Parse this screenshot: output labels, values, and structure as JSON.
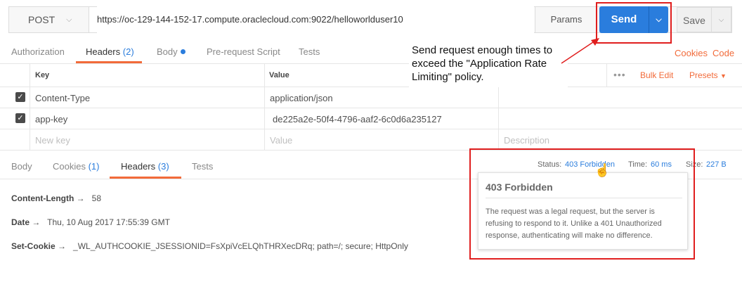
{
  "request": {
    "method": "POST",
    "url": "https://oc-129-144-152-17.compute.oraclecloud.com:9022/helloworlduser10",
    "params_label": "Params",
    "send_label": "Send",
    "save_label": "Save"
  },
  "request_tabs": [
    {
      "label": "Authorization"
    },
    {
      "label": "Headers",
      "count": "(2)"
    },
    {
      "label": "Body"
    },
    {
      "label": "Pre-request Script"
    },
    {
      "label": "Tests"
    }
  ],
  "links": {
    "cookies": "Cookies",
    "code": "Code"
  },
  "headers_table": {
    "col_key": "Key",
    "col_value": "Value",
    "bulk_edit": "Bulk Edit",
    "presets": "Presets",
    "rows": [
      {
        "key": "Content-Type",
        "value": "application/json",
        "checked": true
      },
      {
        "key": "app-key",
        "value": "de225a2e-50f4-4796-aaf2-6c0d6a235127",
        "checked": true
      }
    ],
    "new_row": {
      "key": "New key",
      "value": "Value",
      "description": "Description"
    }
  },
  "annotation": {
    "text": "Send request enough times to exceed the \"Application Rate Limiting\" policy."
  },
  "response_tabs": [
    {
      "label": "Body"
    },
    {
      "label": "Cookies",
      "count": "(1)"
    },
    {
      "label": "Headers",
      "count": "(3)"
    },
    {
      "label": "Tests"
    }
  ],
  "response_meta": {
    "status_label": "Status:",
    "status_value": "403 Forbidden",
    "time_label": "Time:",
    "time_value": "60 ms",
    "size_label": "Size:",
    "size_value": "227 B"
  },
  "tooltip": {
    "title": "403 Forbidden",
    "description": "The request was a legal request, but the server is refusing to respond to it. Unlike a 401 Unauthorized response, authenticating will make no difference."
  },
  "response_headers": [
    {
      "name": "Content-Length",
      "arrow": "→",
      "value": "58"
    },
    {
      "name": "Date",
      "arrow": "→",
      "value": "Thu, 10 Aug 2017 17:55:39 GMT"
    },
    {
      "name": "Set-Cookie",
      "arrow": "→",
      "value": "_WL_AUTHCOOKIE_JSESSIONID=FsXpiVcELQhTHRXecDRq; path=/; secure; HttpOnly"
    }
  ],
  "colors": {
    "accent": "#f26b3a",
    "primary": "#2a7ddd",
    "highlight": "#e01e1e"
  }
}
